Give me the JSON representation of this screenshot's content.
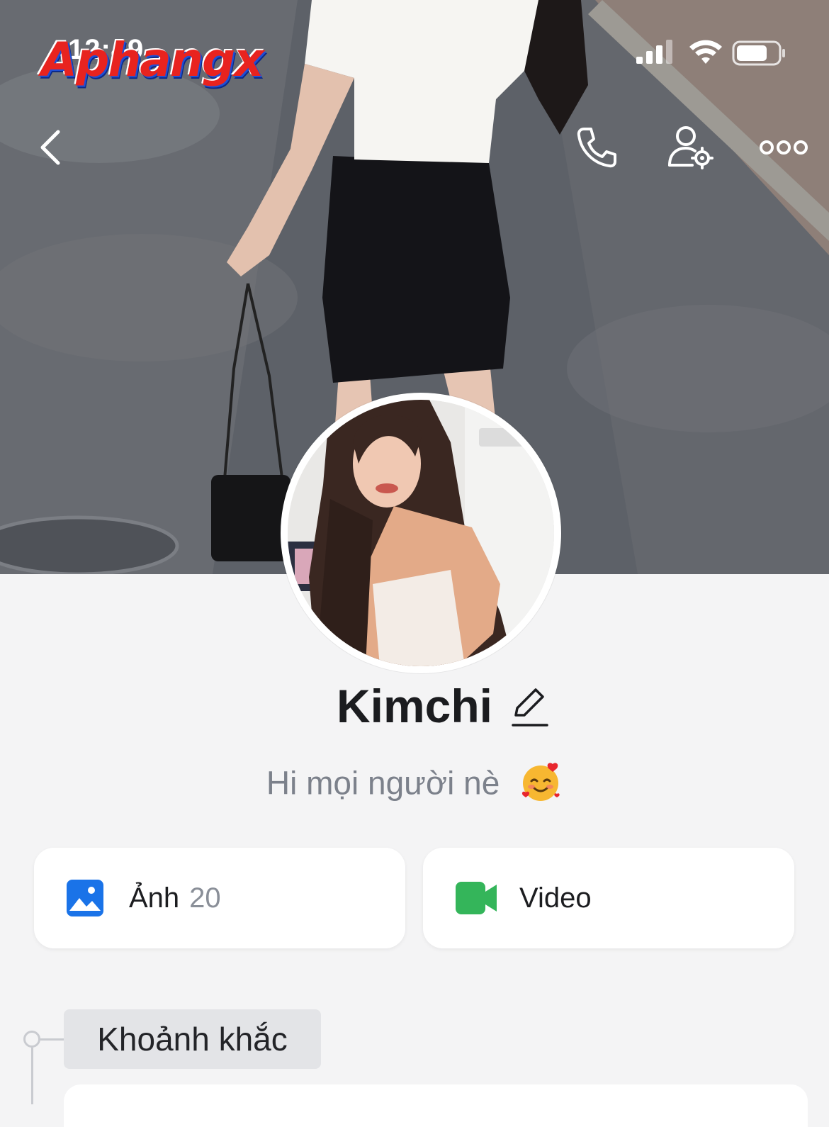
{
  "status_bar": {
    "time": "12:49",
    "watermark": "Aphangx"
  },
  "header": {
    "back_icon": "chevron-left-icon",
    "call_icon": "phone-icon",
    "settings_icon": "user-settings-icon",
    "more_icon": "more-horizontal-icon"
  },
  "profile": {
    "name": "Kimchi",
    "edit_icon": "pencil-icon",
    "bio": "Hi mọi người nè",
    "bio_emoji": "🥰"
  },
  "media": {
    "photos": {
      "label": "Ảnh",
      "count": "20",
      "icon": "image-icon",
      "color": "#1a73e8"
    },
    "videos": {
      "label": "Video",
      "icon": "video-camera-icon",
      "color": "#34b55a"
    }
  },
  "timeline": {
    "section_title": "Khoảnh khắc"
  }
}
